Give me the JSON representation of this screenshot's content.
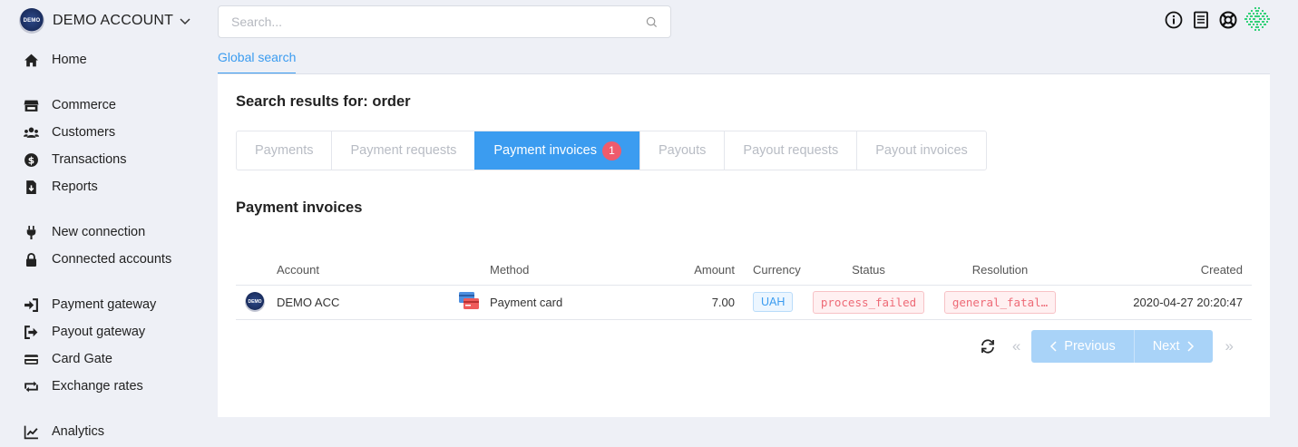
{
  "account": {
    "name": "DEMO ACCOUNT",
    "logo_text": "DEMO"
  },
  "search": {
    "placeholder": "Search..."
  },
  "page_tab": "Global search",
  "sidebar": {
    "items": [
      {
        "label": "Home",
        "icon": "home-icon"
      },
      {
        "label": "Commerce",
        "icon": "store-icon"
      },
      {
        "label": "Customers",
        "icon": "users-icon"
      },
      {
        "label": "Transactions",
        "icon": "dollar-icon"
      },
      {
        "label": "Reports",
        "icon": "file-download-icon"
      },
      {
        "label": "New connection",
        "icon": "plug-icon"
      },
      {
        "label": "Connected accounts",
        "icon": "lock-icon"
      },
      {
        "label": "Payment gateway",
        "icon": "sign-in-icon"
      },
      {
        "label": "Payout gateway",
        "icon": "sign-out-icon"
      },
      {
        "label": "Card Gate",
        "icon": "credit-card-icon"
      },
      {
        "label": "Exchange rates",
        "icon": "exchange-icon"
      },
      {
        "label": "Analytics",
        "icon": "chart-line-icon"
      }
    ]
  },
  "results": {
    "title": "Search results for: order",
    "tabs": [
      {
        "label": "Payments"
      },
      {
        "label": "Payment requests"
      },
      {
        "label": "Payment invoices",
        "badge": "1",
        "active": true
      },
      {
        "label": "Payouts"
      },
      {
        "label": "Payout requests"
      },
      {
        "label": "Payout invoices"
      }
    ],
    "section_title": "Payment invoices",
    "columns": [
      "Account",
      "Method",
      "Amount",
      "Currency",
      "Status",
      "Resolution",
      "Created"
    ],
    "rows": [
      {
        "account": "DEMO ACC",
        "account_logo": "DEMO",
        "method": "Payment card",
        "amount": "7.00",
        "currency": "UAH",
        "status": "process_failed",
        "resolution": "general_fatal…",
        "created": "2020-04-27 20:20:47"
      }
    ]
  },
  "pager": {
    "prev": "Previous",
    "next": "Next",
    "first": "«",
    "last": "»"
  },
  "colors": {
    "accent": "#3b9cf0",
    "badge": "#ef5b6c",
    "error": "#ee6a76"
  }
}
